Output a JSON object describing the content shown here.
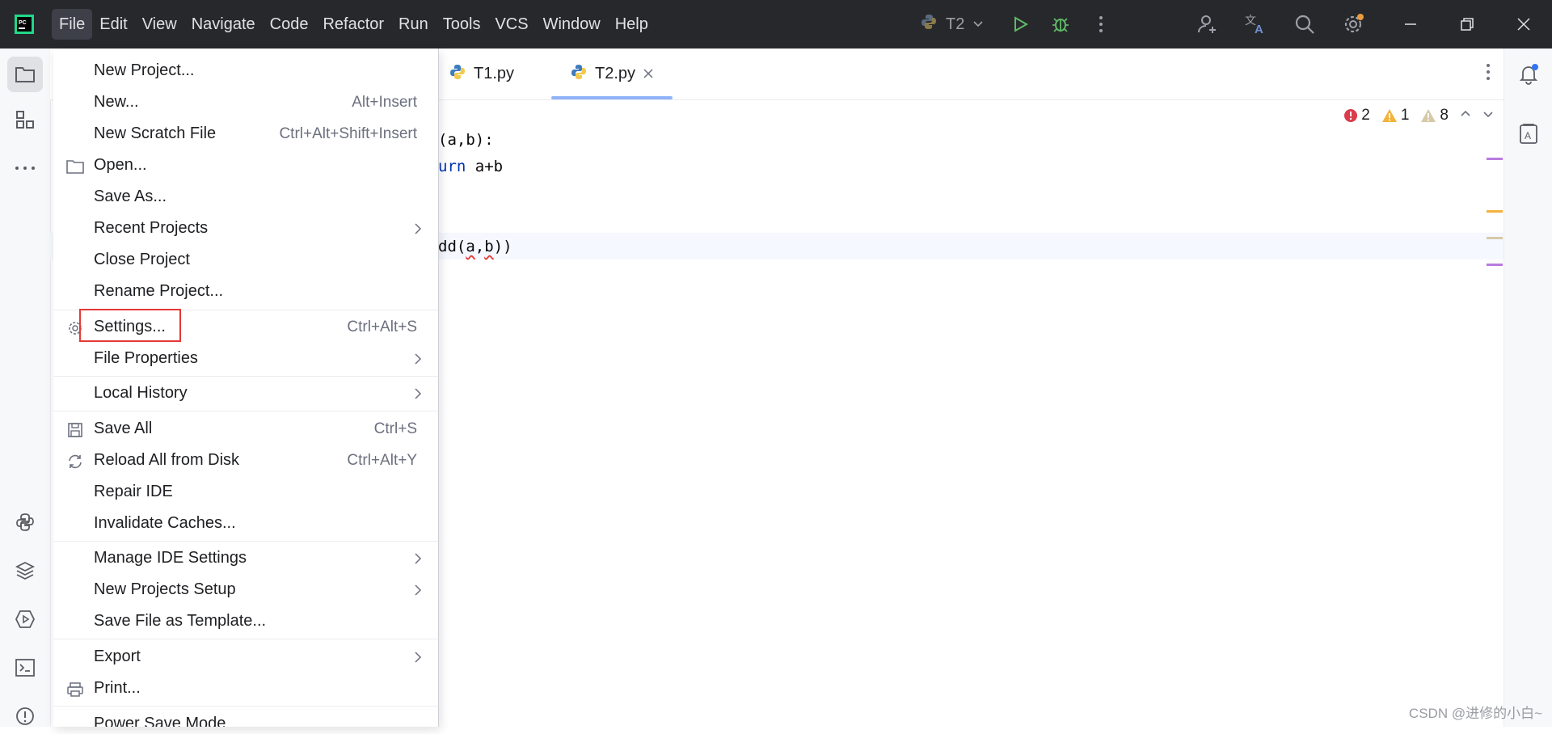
{
  "menubar": {
    "items": [
      {
        "label": "File",
        "active": true
      },
      {
        "label": "Edit"
      },
      {
        "label": "View"
      },
      {
        "label": "Navigate"
      },
      {
        "label": "Code"
      },
      {
        "label": "Refactor"
      },
      {
        "label": "Run"
      },
      {
        "label": "Tools"
      },
      {
        "label": "VCS"
      },
      {
        "label": "Window"
      },
      {
        "label": "Help"
      }
    ]
  },
  "toolbar": {
    "run_config": "T2"
  },
  "tabs": [
    {
      "label": "T1.py"
    },
    {
      "label": "T2.py",
      "selected": true
    }
  ],
  "inspections": {
    "errors": "2",
    "warnings": "1",
    "weak_warnings": "8"
  },
  "code": {
    "line1": "(a,b):",
    "line2_kw": "urn",
    "line2_rest": " a+b",
    "line4_pre": "dd(",
    "line4_a": "a",
    "line4_comma": ",",
    "line4_b": "b",
    "line4_post": "))"
  },
  "file_menu": {
    "items": [
      {
        "label": "New Project...",
        "shortcut": ""
      },
      {
        "label": "New...",
        "shortcut": "Alt+Insert"
      },
      {
        "label": "New Scratch File",
        "shortcut": "Ctrl+Alt+Shift+Insert"
      },
      {
        "label": "Open...",
        "shortcut": "",
        "icon": "folder-icon"
      },
      {
        "label": "Save As...",
        "shortcut": ""
      },
      {
        "label": "Recent Projects",
        "submenu": true
      },
      {
        "label": "Close Project",
        "shortcut": ""
      },
      {
        "label": "Rename Project...",
        "shortcut": ""
      },
      {
        "label": "Settings...",
        "shortcut": "Ctrl+Alt+S",
        "icon": "gear-icon",
        "highlighted": true
      },
      {
        "label": "File Properties",
        "submenu": true
      },
      {
        "label": "Local History",
        "submenu": true
      },
      {
        "label": "Save All",
        "shortcut": "Ctrl+S",
        "icon": "save-icon"
      },
      {
        "label": "Reload All from Disk",
        "shortcut": "Ctrl+Alt+Y",
        "icon": "reload-icon"
      },
      {
        "label": "Repair IDE",
        "shortcut": ""
      },
      {
        "label": "Invalidate Caches...",
        "shortcut": ""
      },
      {
        "label": "Manage IDE Settings",
        "submenu": true
      },
      {
        "label": "New Projects Setup",
        "submenu": true
      },
      {
        "label": "Save File as Template...",
        "shortcut": ""
      },
      {
        "label": "Export",
        "submenu": true
      },
      {
        "label": "Print...",
        "shortcut": "",
        "icon": "printer-icon"
      },
      {
        "label": "Power Save Mode",
        "shortcut": ""
      }
    ]
  },
  "watermark": "CSDN @进修的小白~",
  "colors": {
    "titlebar": "#27282c",
    "highlight_border": "#e53935",
    "error": "#db3b4b",
    "warning": "#f2b33d",
    "keyword": "#0033b3"
  }
}
